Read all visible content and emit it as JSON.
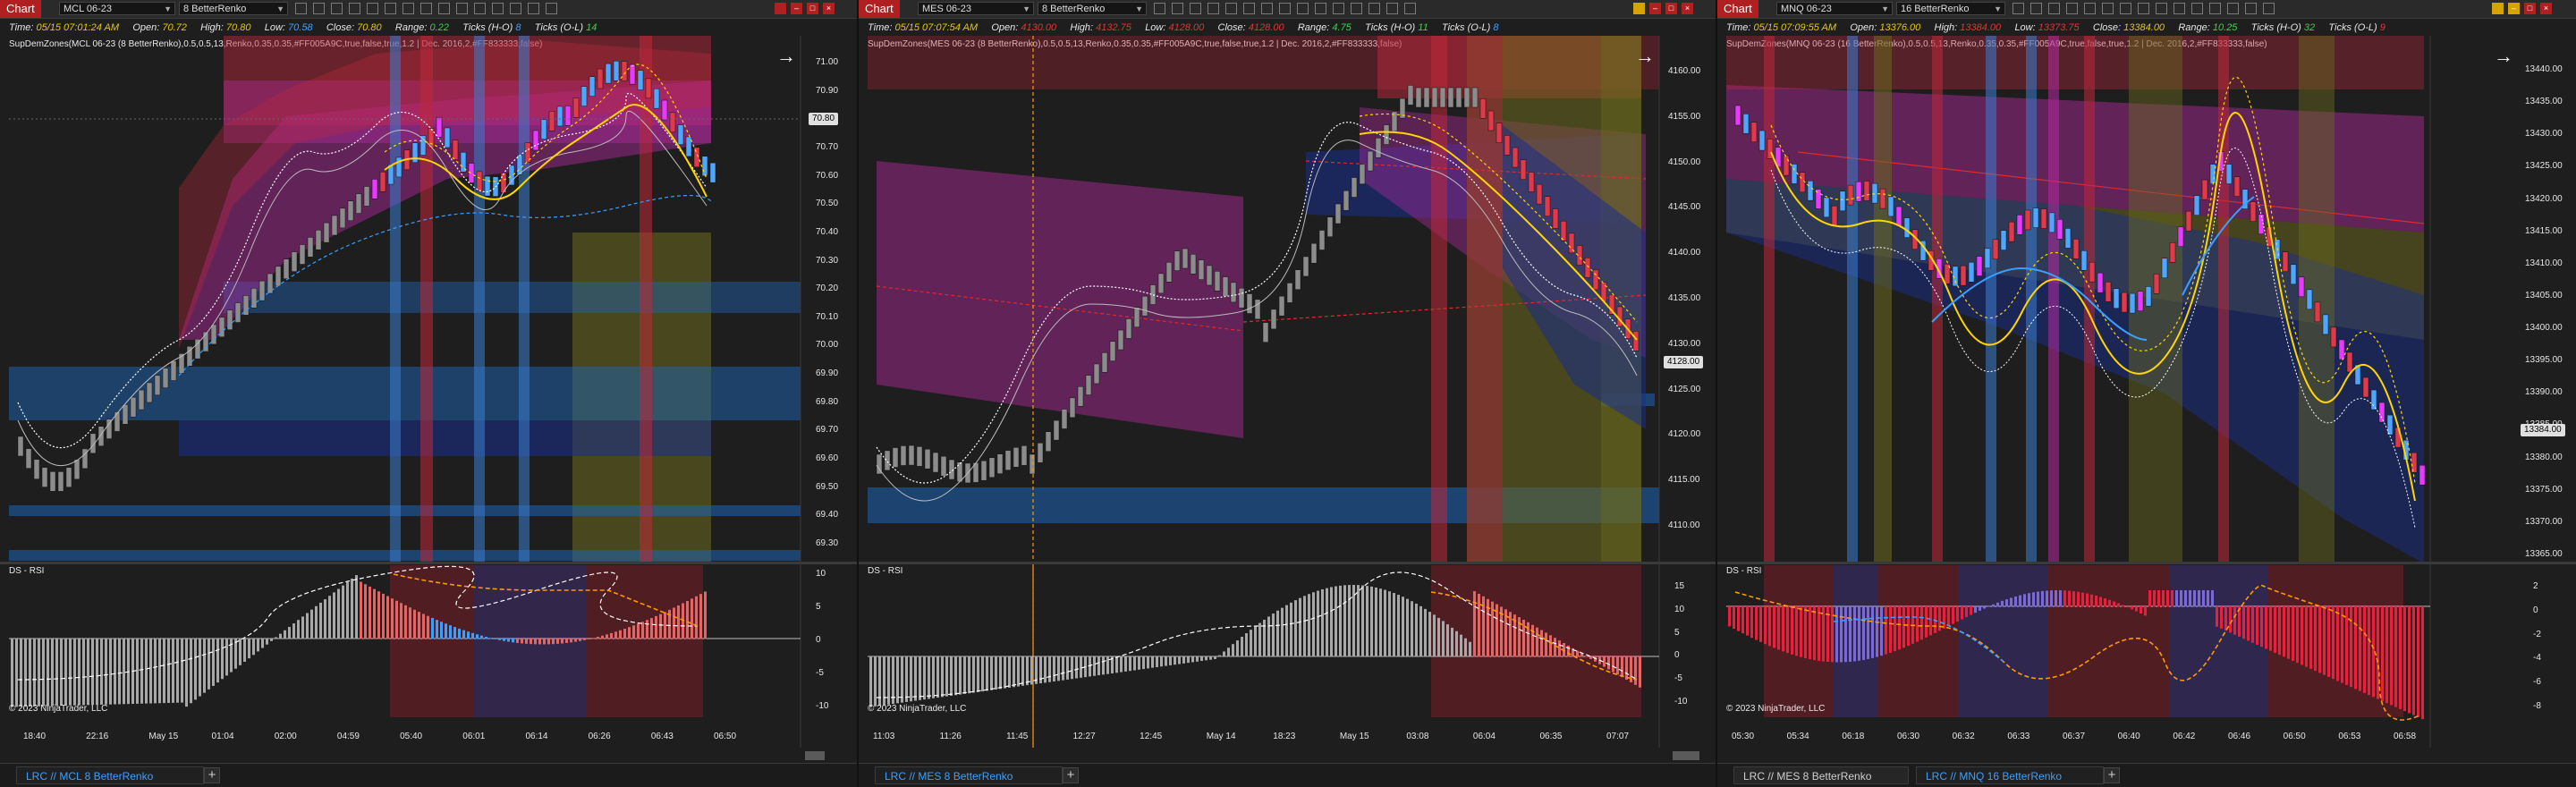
{
  "windows": [
    {
      "chart_label": "Chart",
      "instrument": "MCL 06-23",
      "bar_type": "8 BetterRenko",
      "info": {
        "time_label": "Time:",
        "time_value": "05/15 07:01:24 AM",
        "open_label": "Open:",
        "open_value": "70.72",
        "high_label": "High:",
        "high_value": "70.80",
        "low_label": "Low:",
        "low_value": "70.58",
        "close_label": "Close:",
        "close_value": "70.80",
        "range_label": "Range:",
        "range_value": "0.22",
        "ticks_ho_label": "Ticks (H-O)",
        "ticks_ho_value": "8",
        "ticks_ol_label": "Ticks (O-L)",
        "ticks_ol_value": "14"
      },
      "indicator_text": "SupDemZones(MCL 06-23 (8 BetterRenko),0.5,0.5,13,Renko,0.35,0.35,#FF005A9C,true,false,true,1.2 | Dec. 2016,2,#FF833333,false)",
      "price_labels": [
        "71.00",
        "70.90",
        "70.80",
        "70.70",
        "70.60",
        "70.50",
        "70.40",
        "70.30",
        "70.20",
        "70.10",
        "70.00",
        "69.90",
        "69.80",
        "69.70",
        "69.60",
        "69.50",
        "69.40",
        "69.30"
      ],
      "current_price": "70.80",
      "rsi_title": "DS - RSI",
      "rsi_labels": [
        "10",
        "5",
        "0",
        "-5",
        "-10"
      ],
      "copyright": "© 2023 NinjaTrader, LLC",
      "time_labels": [
        "18:40",
        "22:16",
        "May 15",
        "01:04",
        "02:00",
        "04:59",
        "05:40",
        "06:01",
        "06:14",
        "06:26",
        "06:43",
        "06:50"
      ],
      "tabs": [
        {
          "label": "LRC // MCL  8 BetterRenko",
          "active": true
        }
      ],
      "add_tab": "+"
    },
    {
      "chart_label": "Chart",
      "instrument": "MES 06-23",
      "bar_type": "8 BetterRenko",
      "info": {
        "time_label": "Time:",
        "time_value": "05/15 07:07:54 AM",
        "open_label": "Open:",
        "open_value": "4130.00",
        "high_label": "High:",
        "high_value": "4132.75",
        "low_label": "Low:",
        "low_value": "4128.00",
        "close_label": "Close:",
        "close_value": "4128.00",
        "range_label": "Range:",
        "range_value": "4.75",
        "ticks_ho_label": "Ticks (H-O)",
        "ticks_ho_value": "11",
        "ticks_ol_label": "Ticks (O-L)",
        "ticks_ol_value": "8"
      },
      "indicator_text": "SupDemZones(MES 06-23 (8 BetterRenko),0.5,0.5,13,Renko,0.35,0.35,#FF005A9C,true,false,true,1.2 | Dec. 2016,2,#FF833333,false)",
      "price_labels": [
        "4160.00",
        "4155.00",
        "4150.00",
        "4145.00",
        "4140.00",
        "4135.00",
        "4130.00",
        "4125.00",
        "4120.00",
        "4115.00",
        "4110.00"
      ],
      "current_price": "4128.00",
      "rsi_title": "DS - RSI",
      "rsi_labels": [
        "15",
        "10",
        "5",
        "0",
        "-5",
        "-10"
      ],
      "copyright": "© 2023 NinjaTrader, LLC",
      "time_labels": [
        "11:03",
        "11:26",
        "11:45",
        "12:27",
        "12:45",
        "May 14",
        "18:23",
        "May 15",
        "03:08",
        "06:04",
        "06:35",
        "07:07"
      ],
      "tabs": [
        {
          "label": "LRC // MES  8 BetterRenko",
          "active": true
        }
      ],
      "add_tab": "+"
    },
    {
      "chart_label": "Chart",
      "instrument": "MNQ 06-23",
      "bar_type": "16 BetterRenko",
      "info": {
        "time_label": "Time:",
        "time_value": "05/15 07:09:55 AM",
        "open_label": "Open:",
        "open_value": "13376.00",
        "high_label": "High:",
        "high_value": "13384.00",
        "low_label": "Low:",
        "low_value": "13373.75",
        "close_label": "Close:",
        "close_value": "13384.00",
        "range_label": "Range:",
        "range_value": "10.25",
        "ticks_ho_label": "Ticks (H-O)",
        "ticks_ho_value": "32",
        "ticks_ol_label": "Ticks (O-L)",
        "ticks_ol_value": "9"
      },
      "indicator_text": "SupDemZones(MNQ 06-23 (16 BetterRenko),0.5,0.5,13,Renko,0.35,0.35,#FF005A9C,true,false,true,1.2 | Dec. 2016,2,#FF833333,false)",
      "price_labels": [
        "13440.00",
        "13435.00",
        "13430.00",
        "13425.00",
        "13420.00",
        "13415.00",
        "13410.00",
        "13405.00",
        "13400.00",
        "13395.00",
        "13390.00",
        "13385.00",
        "13380.00",
        "13375.00",
        "13370.00",
        "13365.00"
      ],
      "current_price": "13384.00",
      "rsi_title": "DS - RSI",
      "rsi_labels": [
        "2",
        "0",
        "-2",
        "-4",
        "-6",
        "-8"
      ],
      "copyright": "© 2023 NinjaTrader, LLC",
      "time_labels": [
        "05:30",
        "05:34",
        "06:18",
        "06:30",
        "06:32",
        "06:33",
        "06:37",
        "06:40",
        "06:42",
        "06:46",
        "06:50",
        "06:53",
        "06:58"
      ],
      "tabs": [
        {
          "label": "LRC // MES  8 BetterRenko",
          "active": false
        },
        {
          "label": "LRC // MNQ  16 BetterRenko",
          "active": true
        }
      ],
      "add_tab": "+"
    }
  ],
  "icons": {
    "arrow": "right-arrow-icon"
  },
  "colors": {
    "up": "#4ea6ff",
    "down": "#e03a4a",
    "neutral": "#8c8c8c",
    "supply": "#c0283b",
    "demand": "#1e64b4",
    "magenta": "#b42aa0",
    "olive": "#6b6a1e",
    "ema": "#ffd600"
  }
}
